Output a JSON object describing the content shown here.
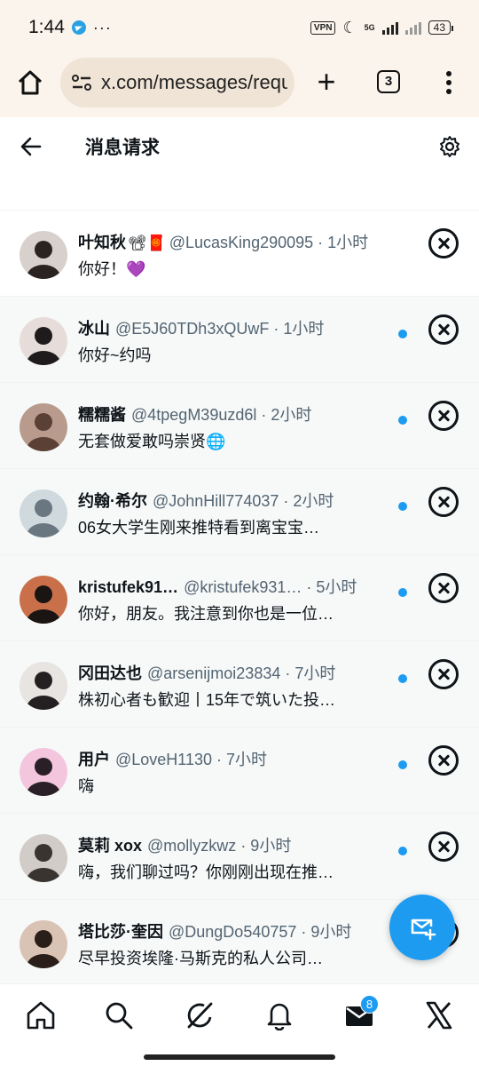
{
  "status_bar": {
    "time": "1:44",
    "more": "···",
    "vpn": "VPN",
    "network": "5G",
    "battery": "43"
  },
  "browser": {
    "url": "x.com/messages/requests",
    "tab_count": "3"
  },
  "header": {
    "title": "消息请求"
  },
  "requests": [
    {
      "name": "叶知秋",
      "emoji": "📽🧧",
      "handle": "@LucasKing290095",
      "time": " · 1小时",
      "preview": "你好！💜",
      "unread": false,
      "avatar_bg": "#d8d0cc",
      "avatar_fg": "#2b2321"
    },
    {
      "name": "冰山",
      "emoji": "",
      "handle": "@E5J60TDh3xQUwF",
      "time": " · 1小时",
      "preview": "你好~约吗",
      "unread": true,
      "avatar_bg": "#e6ddda",
      "avatar_fg": "#1f1b1c"
    },
    {
      "name": "糯糯酱",
      "emoji": "",
      "handle": "@4tpegM39uzd6l",
      "time": " · 2小时",
      "preview": "无套做爱敢吗崇贤🌐",
      "unread": true,
      "avatar_bg": "#b89b8d",
      "avatar_fg": "#5a4035"
    },
    {
      "name": "约翰·希尔",
      "emoji": "",
      "handle": "@JohnHill774037",
      "time": " · 2小时",
      "preview": "06女大学生刚来推特看到离宝宝…",
      "unread": true,
      "avatar_bg": "#cfd9de",
      "avatar_fg": "#6b7780"
    },
    {
      "name": "kristufek91…",
      "emoji": "",
      "handle": "@kristufek931…",
      "time": " · 5小时",
      "preview": "你好，朋友。我注意到你也是一位…",
      "unread": true,
      "avatar_bg": "#c9704a",
      "avatar_fg": "#1a1412"
    },
    {
      "name": "冈田达也",
      "emoji": "",
      "handle": "@arsenijmoi23834",
      "time": " · 7小时",
      "preview": "株初心者も歓迎丨15年で筑いた投…",
      "unread": true,
      "avatar_bg": "#e8e4e2",
      "avatar_fg": "#242022"
    },
    {
      "name": "用户",
      "emoji": "",
      "handle": "@LoveH1130",
      "time": " · 7小时",
      "preview": "嗨",
      "unread": true,
      "avatar_bg": "#f3c6dd",
      "avatar_fg": "#2a1f26"
    },
    {
      "name": "莫莉 xox",
      "emoji": "",
      "handle": "@mollyzkwz",
      "time": " · 9小时",
      "preview": "嗨，我们聊过吗？你刚刚出现在推…",
      "unread": true,
      "avatar_bg": "#d2ccc8",
      "avatar_fg": "#3a3430"
    },
    {
      "name": "塔比莎·奎因",
      "emoji": "",
      "handle": "@DungDo540757",
      "time": " · 9小时",
      "preview": "尽早投资埃隆·马斯克的私人公司…",
      "unread": true,
      "avatar_bg": "#d9c3b4",
      "avatar_fg": "#2a1e18"
    }
  ],
  "bottom_nav": {
    "messages_badge": "8"
  },
  "colors": {
    "accent": "#1d9bf0",
    "text": "#0f1419",
    "muted": "#536471"
  }
}
